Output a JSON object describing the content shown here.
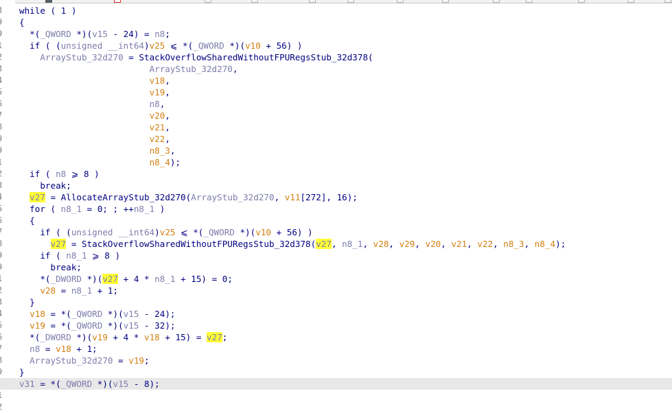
{
  "tabs": [
    {
      "active": false,
      "red": false
    },
    {
      "active": true,
      "red": false
    },
    {
      "active": false,
      "red": true
    },
    {
      "active": false,
      "red": false
    },
    {
      "active": false,
      "red": false
    },
    {
      "active": false,
      "red": false
    },
    {
      "active": false,
      "red": false
    },
    {
      "active": false,
      "red": false
    },
    {
      "active": false,
      "red": false
    },
    {
      "active": false,
      "red": false
    },
    {
      "active": false,
      "red": false
    },
    {
      "active": false,
      "red": false
    },
    {
      "active": false,
      "red": false
    },
    {
      "active": false,
      "red": false
    }
  ],
  "highlighted_identifier": "v27",
  "current_line_index": 32,
  "line_numbers": [
    "3",
    "9",
    "9",
    "1",
    "2",
    "3",
    "4",
    "5",
    "6",
    "7",
    "8",
    "9",
    "9",
    "1",
    "2",
    "3",
    "4",
    "5",
    "6",
    "7",
    "8",
    "9",
    "9",
    "1",
    "2",
    "3",
    "4",
    "5",
    "6",
    "7",
    "8",
    "9",
    "9",
    "1",
    "2"
  ],
  "lines": [
    [
      {
        "t": "while",
        "c": "kw"
      },
      {
        "t": " ( ",
        "c": "op"
      },
      {
        "t": "1",
        "c": "num"
      },
      {
        "t": " )",
        "c": "op"
      }
    ],
    [
      {
        "t": "{",
        "c": "op"
      }
    ],
    [
      {
        "t": "  *(",
        "c": "op"
      },
      {
        "t": "_QWORD",
        "c": "typ"
      },
      {
        "t": " *)(",
        "c": "op"
      },
      {
        "t": "v15",
        "c": "var"
      },
      {
        "t": " - 24) = ",
        "c": "op"
      },
      {
        "t": "n8",
        "c": "var"
      },
      {
        "t": ";",
        "c": "op"
      }
    ],
    [
      {
        "t": "  if ( (",
        "c": "op"
      },
      {
        "t": "unsigned __int64",
        "c": "typ"
      },
      {
        "t": ")",
        "c": "op"
      },
      {
        "t": "v25",
        "c": "loc"
      },
      {
        "t": " ⩽ *(",
        "c": "op"
      },
      {
        "t": "_QWORD",
        "c": "typ"
      },
      {
        "t": " *)(",
        "c": "op"
      },
      {
        "t": "v10",
        "c": "loc"
      },
      {
        "t": " + 56) )",
        "c": "op"
      }
    ],
    [
      {
        "t": "    ",
        "c": "op"
      },
      {
        "t": "ArrayStub_32d270",
        "c": "var"
      },
      {
        "t": " = ",
        "c": "op"
      },
      {
        "t": "StackOverflowSharedWithoutFPURegsStub_32d378",
        "c": "fn"
      },
      {
        "t": "(",
        "c": "op"
      }
    ],
    [
      {
        "t": "                         ",
        "c": "op"
      },
      {
        "t": "ArrayStub_32d270",
        "c": "var"
      },
      {
        "t": ",",
        "c": "op"
      }
    ],
    [
      {
        "t": "                         ",
        "c": "op"
      },
      {
        "t": "v18",
        "c": "loc"
      },
      {
        "t": ",",
        "c": "op"
      }
    ],
    [
      {
        "t": "                         ",
        "c": "op"
      },
      {
        "t": "v19",
        "c": "loc"
      },
      {
        "t": ",",
        "c": "op"
      }
    ],
    [
      {
        "t": "                         ",
        "c": "op"
      },
      {
        "t": "n8",
        "c": "var"
      },
      {
        "t": ",",
        "c": "op"
      }
    ],
    [
      {
        "t": "                         ",
        "c": "op"
      },
      {
        "t": "v20",
        "c": "loc"
      },
      {
        "t": ",",
        "c": "op"
      }
    ],
    [
      {
        "t": "                         ",
        "c": "op"
      },
      {
        "t": "v21",
        "c": "loc"
      },
      {
        "t": ",",
        "c": "op"
      }
    ],
    [
      {
        "t": "                         ",
        "c": "op"
      },
      {
        "t": "v22",
        "c": "loc"
      },
      {
        "t": ",",
        "c": "op"
      }
    ],
    [
      {
        "t": "                         ",
        "c": "op"
      },
      {
        "t": "n8_3",
        "c": "loc"
      },
      {
        "t": ",",
        "c": "op"
      }
    ],
    [
      {
        "t": "                         ",
        "c": "op"
      },
      {
        "t": "n8_4",
        "c": "loc"
      },
      {
        "t": ");",
        "c": "op"
      }
    ],
    [
      {
        "t": "  if ( ",
        "c": "op"
      },
      {
        "t": "n8",
        "c": "var"
      },
      {
        "t": " ⩾ 8 )",
        "c": "op"
      }
    ],
    [
      {
        "t": "    break;",
        "c": "op"
      }
    ],
    [
      {
        "t": "  ",
        "c": "op"
      },
      {
        "t": "v27",
        "c": "var"
      },
      {
        "t": " = ",
        "c": "op"
      },
      {
        "t": "AllocateArrayStub_32d270",
        "c": "fn"
      },
      {
        "t": "(",
        "c": "op"
      },
      {
        "t": "ArrayStub_32d270",
        "c": "var"
      },
      {
        "t": ", ",
        "c": "op"
      },
      {
        "t": "v11",
        "c": "loc"
      },
      {
        "t": "[272], 16);",
        "c": "op"
      }
    ],
    [
      {
        "t": "  for ( ",
        "c": "op"
      },
      {
        "t": "n8_1",
        "c": "var"
      },
      {
        "t": " = 0; ; ++",
        "c": "op"
      },
      {
        "t": "n8_1",
        "c": "var"
      },
      {
        "t": " )",
        "c": "op"
      }
    ],
    [
      {
        "t": "  {",
        "c": "op"
      }
    ],
    [
      {
        "t": "    if ( (",
        "c": "op"
      },
      {
        "t": "unsigned __int64",
        "c": "typ"
      },
      {
        "t": ")",
        "c": "op"
      },
      {
        "t": "v25",
        "c": "loc"
      },
      {
        "t": " ⩽ *(",
        "c": "op"
      },
      {
        "t": "_QWORD",
        "c": "typ"
      },
      {
        "t": " *)(",
        "c": "op"
      },
      {
        "t": "v10",
        "c": "loc"
      },
      {
        "t": " + 56) )",
        "c": "op"
      }
    ],
    [
      {
        "t": "      ",
        "c": "op"
      },
      {
        "t": "v27",
        "c": "var"
      },
      {
        "t": " = ",
        "c": "op"
      },
      {
        "t": "StackOverflowSharedWithoutFPURegsStub_32d378",
        "c": "fn"
      },
      {
        "t": "(",
        "c": "op"
      },
      {
        "t": "v27",
        "c": "var"
      },
      {
        "t": ", ",
        "c": "op"
      },
      {
        "t": "n8_1",
        "c": "var"
      },
      {
        "t": ", ",
        "c": "op"
      },
      {
        "t": "v28",
        "c": "loc"
      },
      {
        "t": ", ",
        "c": "op"
      },
      {
        "t": "v29",
        "c": "loc"
      },
      {
        "t": ", ",
        "c": "op"
      },
      {
        "t": "v20",
        "c": "loc"
      },
      {
        "t": ", ",
        "c": "op"
      },
      {
        "t": "v21",
        "c": "loc"
      },
      {
        "t": ", ",
        "c": "op"
      },
      {
        "t": "v22",
        "c": "loc"
      },
      {
        "t": ", ",
        "c": "op"
      },
      {
        "t": "n8_3",
        "c": "loc"
      },
      {
        "t": ", ",
        "c": "op"
      },
      {
        "t": "n8_4",
        "c": "loc"
      },
      {
        "t": ");",
        "c": "op"
      }
    ],
    [
      {
        "t": "    if ( ",
        "c": "op"
      },
      {
        "t": "n8_1",
        "c": "var"
      },
      {
        "t": " ⩾ 8 )",
        "c": "op"
      }
    ],
    [
      {
        "t": "      break;",
        "c": "op"
      }
    ],
    [
      {
        "t": "    *(",
        "c": "op"
      },
      {
        "t": "_DWORD",
        "c": "typ"
      },
      {
        "t": " *)(",
        "c": "op"
      },
      {
        "t": "v27",
        "c": "var"
      },
      {
        "t": " + 4 * ",
        "c": "op"
      },
      {
        "t": "n8_1",
        "c": "var"
      },
      {
        "t": " + 15) = 0;",
        "c": "op"
      }
    ],
    [
      {
        "t": "    ",
        "c": "op"
      },
      {
        "t": "v28",
        "c": "loc"
      },
      {
        "t": " = ",
        "c": "op"
      },
      {
        "t": "n8_1",
        "c": "var"
      },
      {
        "t": " + 1;",
        "c": "op"
      }
    ],
    [
      {
        "t": "  }",
        "c": "op"
      }
    ],
    [
      {
        "t": "  ",
        "c": "op"
      },
      {
        "t": "v18",
        "c": "loc"
      },
      {
        "t": " = *(",
        "c": "op"
      },
      {
        "t": "_QWORD",
        "c": "typ"
      },
      {
        "t": " *)(",
        "c": "op"
      },
      {
        "t": "v15",
        "c": "var"
      },
      {
        "t": " - 24);",
        "c": "op"
      }
    ],
    [
      {
        "t": "  ",
        "c": "op"
      },
      {
        "t": "v19",
        "c": "loc"
      },
      {
        "t": " = *(",
        "c": "op"
      },
      {
        "t": "_QWORD",
        "c": "typ"
      },
      {
        "t": " *)(",
        "c": "op"
      },
      {
        "t": "v15",
        "c": "var"
      },
      {
        "t": " - 32);",
        "c": "op"
      }
    ],
    [
      {
        "t": "  *(",
        "c": "op"
      },
      {
        "t": "_DWORD",
        "c": "typ"
      },
      {
        "t": " *)(",
        "c": "op"
      },
      {
        "t": "v19",
        "c": "loc"
      },
      {
        "t": " + 4 * ",
        "c": "op"
      },
      {
        "t": "v18",
        "c": "loc"
      },
      {
        "t": " + 15) = ",
        "c": "op"
      },
      {
        "t": "v27",
        "c": "var"
      },
      {
        "t": ";",
        "c": "op"
      }
    ],
    [
      {
        "t": "  ",
        "c": "op"
      },
      {
        "t": "n8",
        "c": "var"
      },
      {
        "t": " = ",
        "c": "op"
      },
      {
        "t": "v18",
        "c": "loc"
      },
      {
        "t": " + 1;",
        "c": "op"
      }
    ],
    [
      {
        "t": "  ",
        "c": "op"
      },
      {
        "t": "ArrayStub_32d270",
        "c": "var"
      },
      {
        "t": " = ",
        "c": "op"
      },
      {
        "t": "v19",
        "c": "loc"
      },
      {
        "t": ";",
        "c": "op"
      }
    ],
    [
      {
        "t": "}",
        "c": "op"
      }
    ],
    [
      {
        "t": "v31",
        "c": "var"
      },
      {
        "t": " = *(",
        "c": "op"
      },
      {
        "t": "_QWORD",
        "c": "typ"
      },
      {
        "t": " *)(",
        "c": "op"
      },
      {
        "t": "v15",
        "c": "var"
      },
      {
        "t": " - 8);",
        "c": "op"
      }
    ]
  ]
}
